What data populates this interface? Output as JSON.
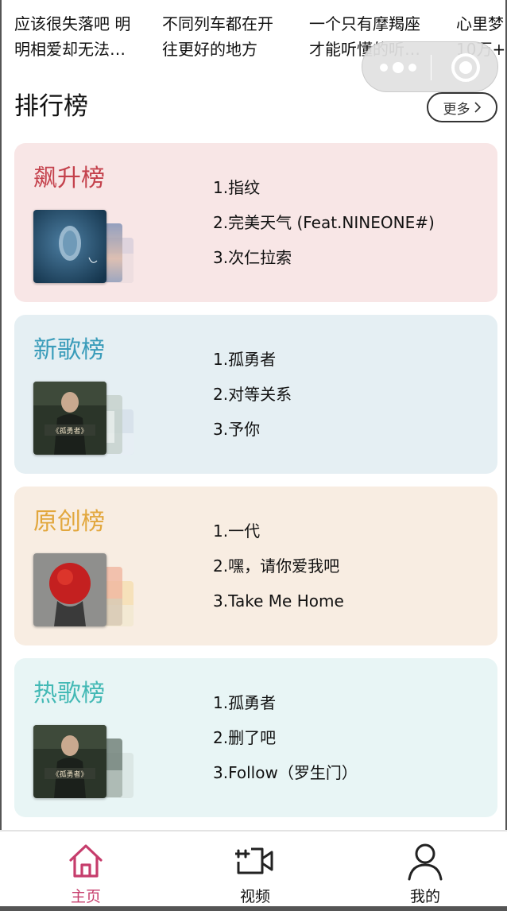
{
  "playlists": [
    {
      "line1": "应该很失落吧 明",
      "line2": "明相爱却无法…"
    },
    {
      "line1": "不同列车都在开",
      "line2": "往更好的地方"
    },
    {
      "line1": "一个只有摩羯座",
      "line2": "才能听懂的听…"
    },
    {
      "line1": "心里梦",
      "line2": "10万+"
    }
  ],
  "capsule": {
    "more_icon": "ellipsis-icon",
    "close_icon": "target-icon"
  },
  "rank": {
    "title": "排行榜",
    "more_label": "更多",
    "charts": [
      {
        "title": "飙升榜",
        "accent": "#c4414c",
        "background": "#f8e6e6",
        "songs": [
          "1.指纹",
          "2.完美天气 (Feat.NINEONE#)",
          "3.次仁拉索"
        ]
      },
      {
        "title": "新歌榜",
        "accent": "#3a9cba",
        "background": "#e5eff3",
        "songs": [
          "1.孤勇者",
          "2.对等关系",
          "3.予你"
        ]
      },
      {
        "title": "原创榜",
        "accent": "#e2a73d",
        "background": "#f8ede2",
        "songs": [
          "1.一代",
          "2.嘿，请你爱我吧",
          "3.Take Me Home"
        ]
      },
      {
        "title": "热歌榜",
        "accent": "#43b9b5",
        "background": "#e8f5f5",
        "songs": [
          "1.孤勇者",
          "2.删了吧",
          "3.Follow（罗生门）"
        ]
      }
    ]
  },
  "tabbar": {
    "active_color": "#c63d6c",
    "tabs": [
      {
        "label": "主页",
        "icon": "home-icon",
        "active": true
      },
      {
        "label": "视频",
        "icon": "video-add-icon",
        "active": false
      },
      {
        "label": "我的",
        "icon": "user-icon",
        "active": false
      }
    ]
  }
}
